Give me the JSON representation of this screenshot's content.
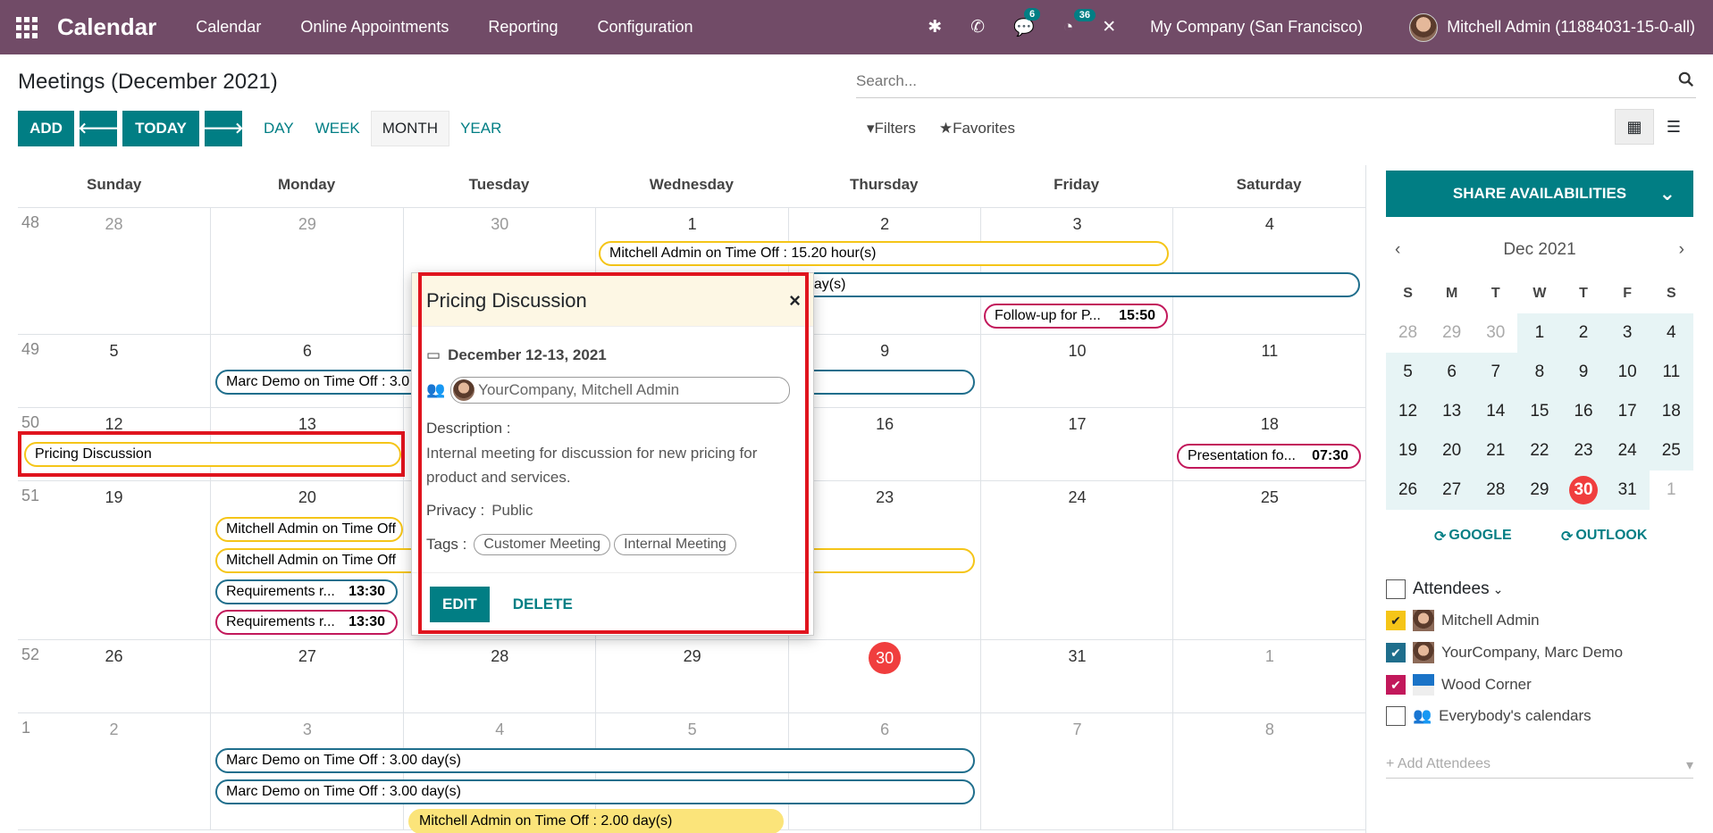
{
  "nav": {
    "brand": "Calendar",
    "menu": [
      "Calendar",
      "Online Appointments",
      "Reporting",
      "Configuration"
    ],
    "chat_badge": "6",
    "activity_badge": "36",
    "company": "My Company (San Francisco)",
    "user": "Mitchell Admin (11884031-15-0-all)"
  },
  "control": {
    "title": "Meetings (December 2021)",
    "search_placeholder": "Search...",
    "add": "ADD",
    "today": "TODAY",
    "views": [
      "DAY",
      "WEEK",
      "MONTH",
      "YEAR"
    ],
    "active_view": "MONTH",
    "filters": "Filters",
    "favorites": "Favorites"
  },
  "calendar": {
    "days": [
      "Sunday",
      "Monday",
      "Tuesday",
      "Wednesday",
      "Thursday",
      "Friday",
      "Saturday"
    ],
    "weeks": [
      {
        "num": "48",
        "dates": [
          "28",
          "29",
          "30",
          "1",
          "2",
          "3",
          "4"
        ],
        "other": [
          0,
          1,
          2
        ]
      },
      {
        "num": "49",
        "dates": [
          "5",
          "6",
          "7",
          "8",
          "9",
          "10",
          "11"
        ],
        "other": []
      },
      {
        "num": "50",
        "dates": [
          "12",
          "13",
          "14",
          "15",
          "16",
          "17",
          "18"
        ],
        "other": []
      },
      {
        "num": "51",
        "dates": [
          "19",
          "20",
          "21",
          "22",
          "23",
          "24",
          "25"
        ],
        "other": []
      },
      {
        "num": "52",
        "dates": [
          "26",
          "27",
          "28",
          "29",
          "30",
          "31",
          "1"
        ],
        "other": [
          6
        ]
      },
      {
        "num": "1",
        "dates": [
          "2",
          "3",
          "4",
          "5",
          "6",
          "7",
          "8"
        ],
        "other": [
          0,
          1,
          2,
          3,
          4,
          5,
          6
        ]
      }
    ],
    "events": {
      "e1": "Mitchell Admin on Time Off : 15.20 hour(s)",
      "e2": "day(s)",
      "e3_name": "Follow-up for P...",
      "e3_time": "15:50",
      "e4": "Marc Demo on Time Off : 3.0",
      "e5": "Pricing Discussion",
      "e6_name": "Presentation fo...",
      "e6_time": "07:30",
      "e7": "Mitchell Admin on Time Off",
      "e8": "Mitchell Admin on Time Off",
      "e9_name": "Requirements r...",
      "e9_time": "13:30",
      "e10_name": "Requirements r...",
      "e10_time": "13:30",
      "e11": "Marc Demo on Time Off : 3.00 day(s)",
      "e12": "Marc Demo on Time Off : 3.00 day(s)",
      "e13": "Mitchell Admin on Time Off : 2.00 day(s)"
    }
  },
  "popup": {
    "title": "Pricing Discussion",
    "date": "December 12-13, 2021",
    "attendees": "YourCompany, Mitchell Admin",
    "description_label": "Description :",
    "description": "Internal meeting for discussion for new pricing for product and services.",
    "privacy_label": "Privacy :",
    "privacy": "Public",
    "tags_label": "Tags :",
    "tags": [
      "Customer Meeting",
      "Internal Meeting"
    ],
    "edit": "EDIT",
    "delete": "DELETE"
  },
  "sidebar": {
    "share": "SHARE AVAILABILITIES",
    "month": "Dec 2021",
    "weekdays": [
      "S",
      "M",
      "T",
      "W",
      "T",
      "F",
      "S"
    ],
    "rows": [
      [
        "28",
        "29",
        "30",
        "1",
        "2",
        "3",
        "4"
      ],
      [
        "5",
        "6",
        "7",
        "8",
        "9",
        "10",
        "11"
      ],
      [
        "12",
        "13",
        "14",
        "15",
        "16",
        "17",
        "18"
      ],
      [
        "19",
        "20",
        "21",
        "22",
        "23",
        "24",
        "25"
      ],
      [
        "26",
        "27",
        "28",
        "29",
        "30",
        "31",
        "1"
      ]
    ],
    "google": "GOOGLE",
    "outlook": "OUTLOOK",
    "attendees_title": "Attendees",
    "attendees": [
      "Mitchell Admin",
      "YourCompany, Marc Demo",
      "Wood Corner",
      "Everybody's calendars"
    ],
    "add_attendees": "+ Add Attendees"
  }
}
